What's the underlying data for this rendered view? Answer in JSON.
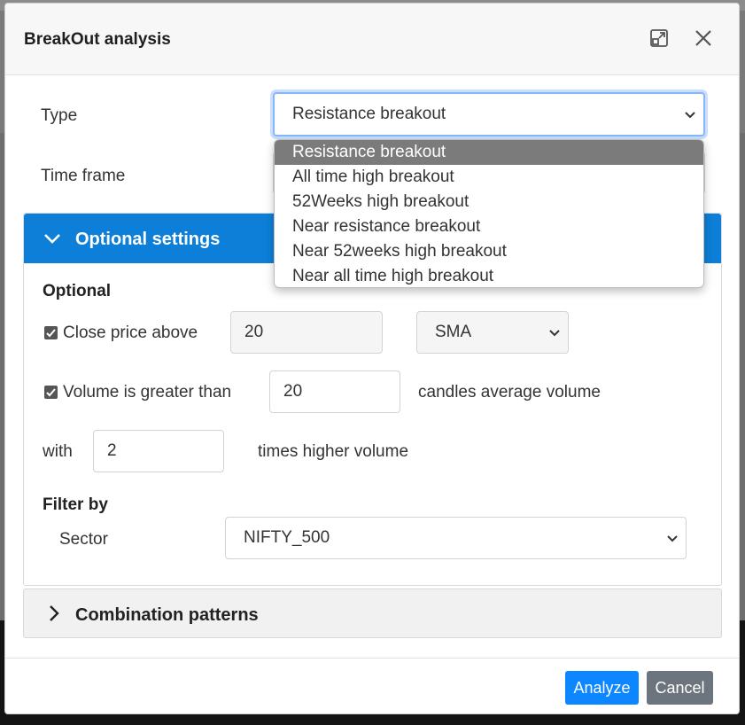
{
  "dialog": {
    "title": "BreakOut analysis"
  },
  "type_field": {
    "label": "Type",
    "selected": "Resistance breakout",
    "options": [
      "Resistance breakout",
      "All time high breakout",
      "52Weeks high breakout",
      "Near resistance breakout",
      "Near 52weeks high breakout",
      "Near all time high breakout"
    ]
  },
  "time_frame": {
    "label": "Time frame"
  },
  "optional_settings": {
    "header": "Optional settings",
    "section_label": "Optional",
    "close_price": {
      "label": "Close price above",
      "checked": true,
      "value": "20",
      "ma_type": "SMA"
    },
    "volume": {
      "label": "Volume is greater than",
      "checked": true,
      "value": "20",
      "suffix": "candles average volume"
    },
    "with": {
      "label": "with",
      "value": "2",
      "suffix": "times higher volume"
    },
    "filter": {
      "label": "Filter by",
      "sector_label": "Sector",
      "sector_value": "NIFTY_500"
    }
  },
  "combination": {
    "header": "Combination patterns"
  },
  "footer": {
    "analyze_label": "Analyze",
    "cancel_label": "Cancel"
  },
  "colors": {
    "accent": "#0d7fd8",
    "primary_button": "#0d87ff",
    "secondary_button": "#6c757d"
  }
}
